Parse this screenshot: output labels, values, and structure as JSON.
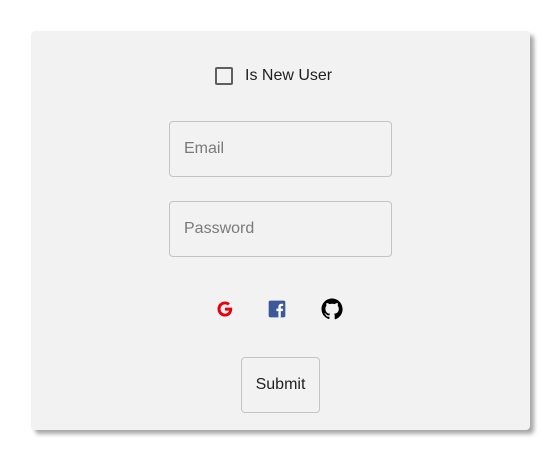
{
  "form": {
    "checkbox": {
      "label": "Is New User",
      "checked": false
    },
    "email": {
      "placeholder": "Email",
      "value": ""
    },
    "password": {
      "placeholder": "Password",
      "value": ""
    },
    "social": [
      {
        "icon": "google-icon",
        "color": "#e8000f"
      },
      {
        "icon": "facebook-icon",
        "color": "#3b5998"
      },
      {
        "icon": "github-icon",
        "color": "#000000"
      }
    ],
    "submit_label": "Submit"
  },
  "colors": {
    "card_background": "#f2f2f2",
    "field_border": "#c4c4c4",
    "text": "#1f1f1f",
    "placeholder": "#7a7a7a"
  }
}
